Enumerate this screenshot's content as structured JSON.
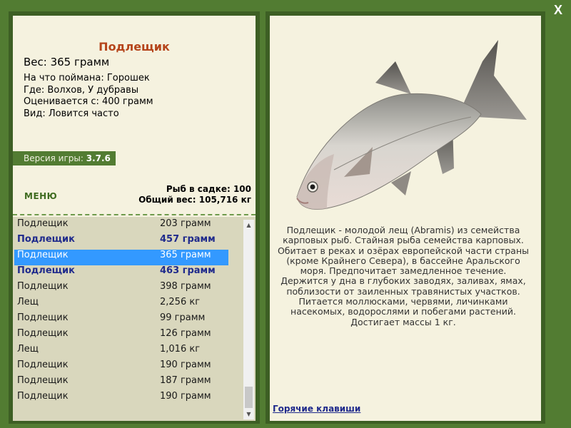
{
  "close_label": "X",
  "fish_info": {
    "name": "Подлещик",
    "weight": "Вес: 365 грамм",
    "lines": [
      "На что поймана: Горошек",
      "Где: Волхов, У дубравы",
      "Оценивается с: 400 грамм",
      "Вид: Ловится часто"
    ]
  },
  "version": {
    "label": "Версия игры:",
    "value": "3.7.6"
  },
  "menu_label": "МЕНЮ",
  "keep": {
    "count_line": "Рыб в садке: 100",
    "total_line": "Общий вес: 105,716 кг"
  },
  "catch_list": [
    {
      "name": "Подлещик",
      "weight": "203 грамм",
      "style": "normal"
    },
    {
      "name": "Подлещик",
      "weight": "457 грамм",
      "style": "bold"
    },
    {
      "name": "Подлещик",
      "weight": "365 грамм",
      "style": "selected"
    },
    {
      "name": "Подлещик",
      "weight": "463 грамм",
      "style": "bold"
    },
    {
      "name": "Подлещик",
      "weight": "398 грамм",
      "style": "normal"
    },
    {
      "name": "Лещ",
      "weight": "2,256 кг",
      "style": "normal"
    },
    {
      "name": "Подлещик",
      "weight": "99 грамм",
      "style": "normal"
    },
    {
      "name": "Подлещик",
      "weight": "126 грамм",
      "style": "normal"
    },
    {
      "name": "Лещ",
      "weight": "1,016 кг",
      "style": "normal"
    },
    {
      "name": "Подлещик",
      "weight": "190 грамм",
      "style": "normal"
    },
    {
      "name": "Подлещик",
      "weight": "187 грамм",
      "style": "normal"
    },
    {
      "name": "Подлещик",
      "weight": "190 грамм",
      "style": "normal"
    }
  ],
  "description": "Подлещик - молодой лещ (Abramis) из семейства карповых рыб. Стайная рыба семейства карповых. Обитает в реках и озёрах европейской части страны (кроме Крайнего Севера), в бассейне Аральского моря. Предпочитает замедленное течение. Держится у дна в глубоких заводях, заливах, ямах, поблизости от заиленных травянистых участков. Питается моллюсками, червями, личинками насекомых, водорослями и побегами растений. Достигает массы 1 кг.",
  "hotkeys_label": "Горячие клавиши",
  "colors": {
    "frame": "#527c32",
    "panel_bg": "#f5f2df",
    "title": "#b5451b",
    "selected": "#3399ff",
    "bold_row": "#1f2a8c"
  }
}
